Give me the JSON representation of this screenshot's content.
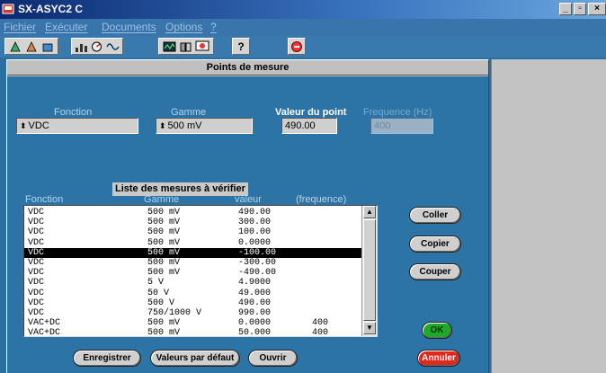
{
  "window": {
    "title": "SX-ASYC2 C",
    "controls": [
      "_",
      "▫",
      "×"
    ]
  },
  "menu": {
    "items": [
      "Fichier",
      "Exécuter",
      "Documents",
      "Options",
      "?"
    ]
  },
  "toolbar": {
    "icons": [
      "tool-a-icon",
      "tool-b-icon",
      "tool-c-icon",
      "chart-icon",
      "meter-icon",
      "wave-icon",
      "scope-icon",
      "compare-icon",
      "help-icon",
      "stop-icon"
    ],
    "help_glyph": "?"
  },
  "dialog": {
    "title": "Points de mesure",
    "fonction_label": "Fonction",
    "gamme_label": "Gamme",
    "valeur_label": "Valeur du point",
    "frequence_label": "Frequence (Hz)",
    "fonction_value": "VDC",
    "gamme_value": "500 mV",
    "valeur_value": "490.00",
    "frequence_value": "400",
    "spin_glyph": "⬍"
  },
  "list": {
    "title": "Liste des mesures à vérifier",
    "headers": {
      "fonction": "Fonction",
      "gamme": "Gamme",
      "valeur": "valeur",
      "frequence": "(frequence)"
    },
    "rows": [
      {
        "fonction": "VDC",
        "gamme": "500 mV",
        "valeur": "490.00",
        "freq": ""
      },
      {
        "fonction": "VDC",
        "gamme": "500 mV",
        "valeur": "300.00",
        "freq": ""
      },
      {
        "fonction": "VDC",
        "gamme": "500 mV",
        "valeur": "100.00",
        "freq": ""
      },
      {
        "fonction": "VDC",
        "gamme": "500 mV",
        "valeur": "0.0000",
        "freq": ""
      },
      {
        "fonction": "VDC",
        "gamme": "500 mV",
        "valeur": "-100.00",
        "freq": ""
      },
      {
        "fonction": "VDC",
        "gamme": "500 mV",
        "valeur": "-300.00",
        "freq": ""
      },
      {
        "fonction": "VDC",
        "gamme": "500 mV",
        "valeur": "-490.00",
        "freq": ""
      },
      {
        "fonction": "VDC",
        "gamme": "5 V",
        "valeur": "4.9000",
        "freq": ""
      },
      {
        "fonction": "VDC",
        "gamme": "50 V",
        "valeur": "49.000",
        "freq": ""
      },
      {
        "fonction": "VDC",
        "gamme": "500 V",
        "valeur": "490.00",
        "freq": ""
      },
      {
        "fonction": "VDC",
        "gamme": "750/1000 V",
        "valeur": "990.00",
        "freq": ""
      },
      {
        "fonction": "VAC+DC",
        "gamme": "500 mV",
        "valeur": "0.0000",
        "freq": "400"
      },
      {
        "fonction": "VAC+DC",
        "gamme": "500 mV",
        "valeur": "50.000",
        "freq": "400"
      }
    ],
    "selected_index": 4,
    "scroll_up": "▲",
    "scroll_down": "▼"
  },
  "buttons": {
    "coller": "Coller",
    "copier": "Copier",
    "couper": "Couper",
    "ok": "OK",
    "annuler": "Annuler",
    "enregistrer": "Enregistrer",
    "valeurs_defaut": "Valeurs par défaut",
    "ouvrir": "Ouvrir"
  },
  "colors": {
    "ok": "#1fa82a",
    "annuler": "#e0281f",
    "panel": "#2c74a6"
  }
}
